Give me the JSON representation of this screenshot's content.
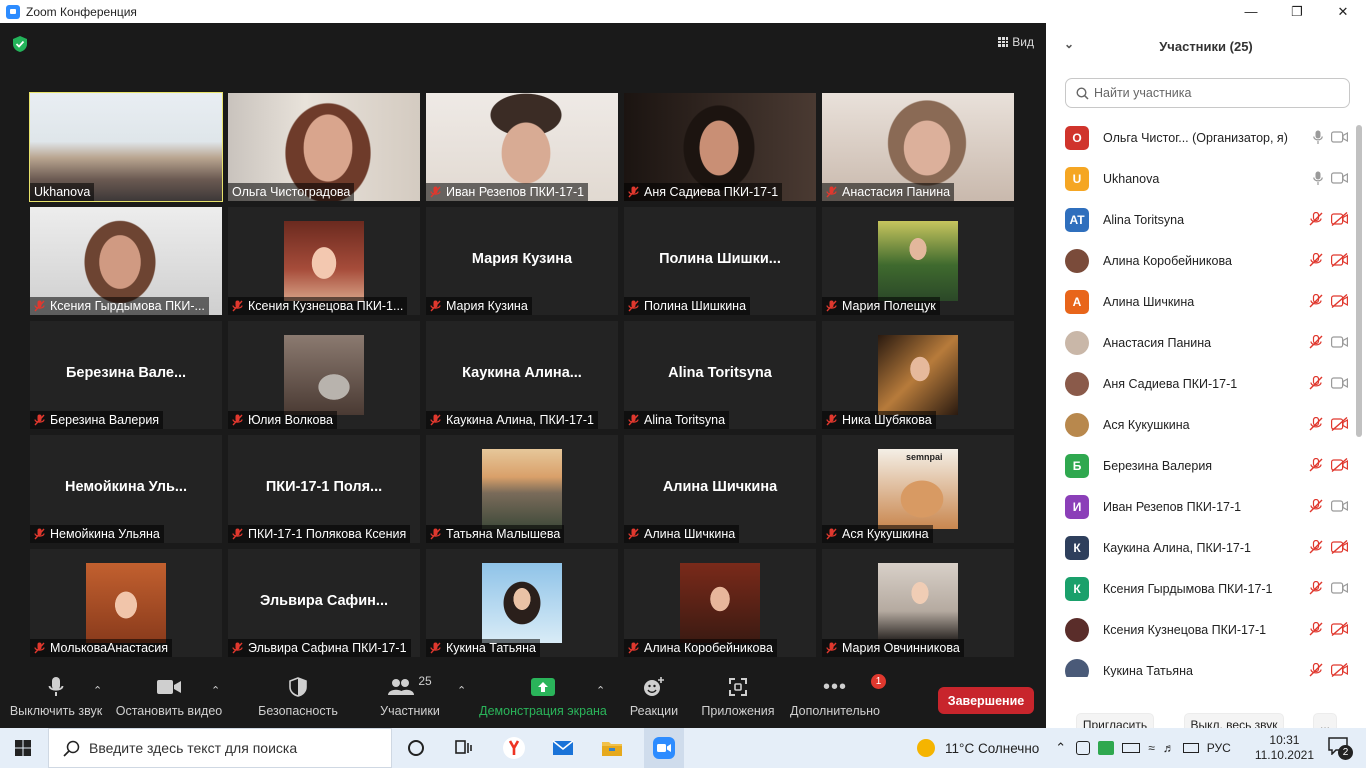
{
  "window": {
    "title": "Zoom Конференция"
  },
  "view_label": "Вид",
  "tiles": [
    {
      "label": "Ukhanova",
      "bigname": "",
      "mic_off": false,
      "kind": "video",
      "img": "room",
      "active": true
    },
    {
      "label": "Ольга Чистоградова",
      "bigname": "",
      "mic_off": false,
      "kind": "video",
      "img": "woman1"
    },
    {
      "label": "Иван Резепов ПКИ-17-1",
      "bigname": "",
      "mic_off": true,
      "kind": "video",
      "img": "man"
    },
    {
      "label": "Аня Садиева ПКИ-17-1",
      "bigname": "",
      "mic_off": true,
      "kind": "video",
      "img": "woman2"
    },
    {
      "label": "Анастасия Панина",
      "bigname": "",
      "mic_off": true,
      "kind": "video",
      "img": "woman3"
    },
    {
      "label": "Ксения Гырдымова ПКИ-...",
      "bigname": "",
      "mic_off": true,
      "kind": "video",
      "img": "woman4"
    },
    {
      "label": "Ксения Кузнецова ПКИ-1...",
      "bigname": "",
      "mic_off": true,
      "kind": "avatar",
      "img": "anime"
    },
    {
      "label": "Мария Кузина",
      "bigname": "Мария Кузина",
      "mic_off": true,
      "kind": "name"
    },
    {
      "label": "Полина Шишкина",
      "bigname": "Полина  Шишки...",
      "mic_off": true,
      "kind": "name"
    },
    {
      "label": "Мария Полещук",
      "bigname": "",
      "mic_off": true,
      "kind": "avatar",
      "img": "forest"
    },
    {
      "label": "Березина Валерия",
      "bigname": "Березина  Вале...",
      "mic_off": true,
      "kind": "name"
    },
    {
      "label": "Юлия Волкова",
      "bigname": "",
      "mic_off": true,
      "kind": "avatar",
      "img": "cat"
    },
    {
      "label": "Каукина Алина, ПКИ-17-1",
      "bigname": "Каукина  Алина...",
      "mic_off": true,
      "kind": "name"
    },
    {
      "label": "Alina Toritsyna",
      "bigname": "Alina Toritsyna",
      "mic_off": true,
      "kind": "name"
    },
    {
      "label": "Ника Шубякова",
      "bigname": "",
      "mic_off": true,
      "kind": "avatar",
      "img": "lights"
    },
    {
      "label": "Немойкина Ульяна",
      "bigname": "Немойкина  Уль...",
      "mic_off": true,
      "kind": "name"
    },
    {
      "label": "ПКИ-17-1 Полякова Ксения",
      "bigname": "ПКИ-17-1  Поля...",
      "mic_off": true,
      "kind": "name"
    },
    {
      "label": "Татьяна Малышева",
      "bigname": "",
      "mic_off": true,
      "kind": "avatar",
      "img": "sunset"
    },
    {
      "label": "Алина Шичкина",
      "bigname": "Алина Шичкина",
      "mic_off": true,
      "kind": "name"
    },
    {
      "label": "Ася Кукушкина",
      "bigname": "",
      "mic_off": true,
      "kind": "avatar",
      "img": "doge",
      "caption": "semnpai"
    },
    {
      "label": "МольковаАнастасия",
      "bigname": "",
      "mic_off": true,
      "kind": "avatar",
      "img": "redhair"
    },
    {
      "label": "Эльвира Сафина ПКИ-17-1",
      "bigname": "Эльвира  Сафин...",
      "mic_off": true,
      "kind": "name"
    },
    {
      "label": "Кукина Татьяна",
      "bigname": "",
      "mic_off": true,
      "kind": "avatar",
      "img": "sky"
    },
    {
      "label": "Алина Коробейникова",
      "bigname": "",
      "mic_off": true,
      "kind": "avatar",
      "img": "books"
    },
    {
      "label": "Мария Овчинникова",
      "bigname": "",
      "mic_off": true,
      "kind": "avatar",
      "img": "blonde"
    }
  ],
  "toolbar": {
    "mute": "Выключить звук",
    "video": "Остановить видео",
    "security": "Безопасность",
    "participants": "Участники",
    "participants_count": "25",
    "share": "Демонстрация экрана",
    "reactions": "Реакции",
    "apps": "Приложения",
    "more": "Дополнительно",
    "more_badge": "1",
    "end": "Завершение"
  },
  "panel": {
    "title": "Участники (25)",
    "search_placeholder": "Найти участника",
    "participants": [
      {
        "initial": "О",
        "name": "Ольга Чистог...  (Организатор, я)",
        "color": "#d0342c",
        "mic": "on",
        "cam": "on"
      },
      {
        "initial": "U",
        "name": "Ukhanova",
        "color": "#f5a623",
        "mic": "on",
        "cam": "on"
      },
      {
        "initial": "AT",
        "name": "Alina Toritsyna",
        "color": "#2f6fbd",
        "mic": "off",
        "cam": "off"
      },
      {
        "initial": "",
        "name": "Алина Коробейникова",
        "color": "#7a4b3a",
        "mic": "off",
        "cam": "off"
      },
      {
        "initial": "А",
        "name": "Алина Шичкина",
        "color": "#e8651a",
        "mic": "off",
        "cam": "off"
      },
      {
        "initial": "",
        "name": "Анастасия Панина",
        "color": "#c9b7a8",
        "mic": "off",
        "cam": "on"
      },
      {
        "initial": "",
        "name": "Аня Садиева ПКИ-17-1",
        "color": "#8a5a4a",
        "mic": "off",
        "cam": "on"
      },
      {
        "initial": "",
        "name": "Ася Кукушкина",
        "color": "#b8884d",
        "mic": "off",
        "cam": "off"
      },
      {
        "initial": "Б",
        "name": "Березина Валерия",
        "color": "#2fa84f",
        "mic": "off",
        "cam": "off"
      },
      {
        "initial": "И",
        "name": "Иван Резепов ПКИ-17-1",
        "color": "#8b3fb8",
        "mic": "off",
        "cam": "on"
      },
      {
        "initial": "К",
        "name": "Каукина Алина, ПКИ-17-1",
        "color": "#2e3f5c",
        "mic": "off",
        "cam": "off"
      },
      {
        "initial": "К",
        "name": "Ксения Гырдымова ПКИ-17-1",
        "color": "#1aa06b",
        "mic": "off",
        "cam": "on"
      },
      {
        "initial": "",
        "name": "Ксения Кузнецова ПКИ-17-1",
        "color": "#5a2d2a",
        "mic": "off",
        "cam": "off"
      },
      {
        "initial": "",
        "name": "Кукина Татьяна",
        "color": "#4a5a78",
        "mic": "off",
        "cam": "off"
      }
    ],
    "invite": "Пригласить",
    "mute_all": "Выкл. весь звук",
    "more": "..."
  },
  "taskbar": {
    "search_placeholder": "Введите здесь текст для поиска",
    "weather": "11°C  Солнечно",
    "lang": "РУС",
    "time": "10:31",
    "date": "11.10.2021",
    "notif_count": "2"
  },
  "colors": {
    "accent": "#2d8cff",
    "end": "#c8252c",
    "active_border": "#e8e36a",
    "share": "#2ab45a",
    "muted": "#e0382e"
  }
}
